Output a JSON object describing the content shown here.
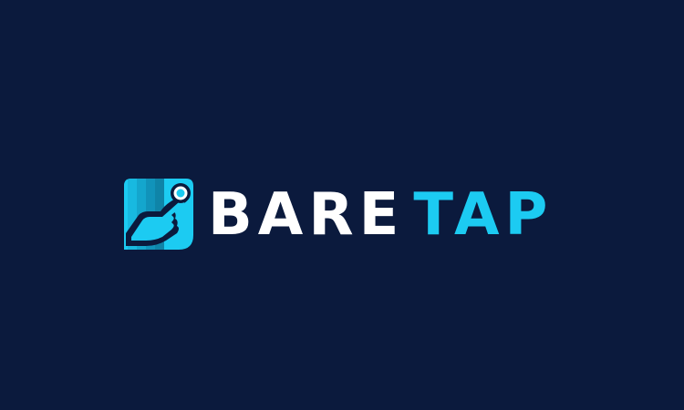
{
  "brand": {
    "name_primary": "BARE",
    "name_accent": "TAP",
    "icon": "tap-finger-icon",
    "colors": {
      "background": "#0b1a3d",
      "primary_text": "#ffffff",
      "accent": "#1ccbf2",
      "accent_dark": "#0f8fb4"
    }
  }
}
